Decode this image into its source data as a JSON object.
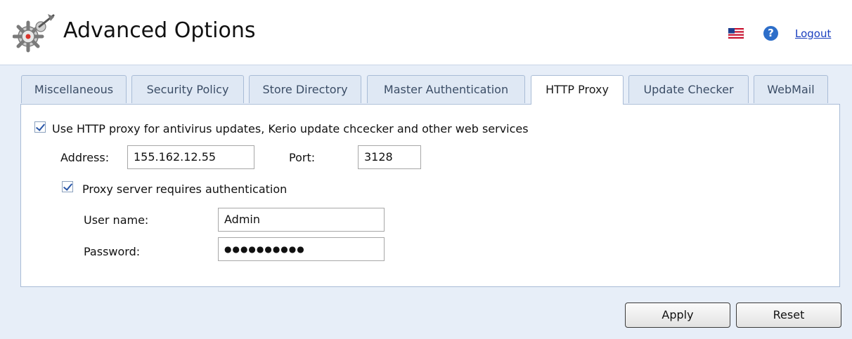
{
  "header": {
    "title": "Advanced Options",
    "logout_label": "Logout",
    "help_glyph": "?",
    "icons": [
      "gear-tools-icon",
      "us-flag-icon",
      "help-icon"
    ]
  },
  "tabs": [
    {
      "label": "Miscellaneous",
      "active": false
    },
    {
      "label": "Security Policy",
      "active": false
    },
    {
      "label": "Store Directory",
      "active": false
    },
    {
      "label": "Master Authentication",
      "active": false
    },
    {
      "label": "HTTP Proxy",
      "active": true
    },
    {
      "label": "Update Checker",
      "active": false
    },
    {
      "label": "WebMail",
      "active": false
    }
  ],
  "proxy": {
    "use_proxy_label": "Use HTTP proxy for antivirus updates, Kerio update chcecker and other web services",
    "use_proxy_checked": true,
    "address_label": "Address:",
    "address_value": "155.162.12.55",
    "port_label": "Port:",
    "port_value": "3128",
    "auth_label": "Proxy server requires authentication",
    "auth_checked": true,
    "username_label": "User name:",
    "username_value": "Admin",
    "password_label": "Password:",
    "password_value": "●●●●●●●●●●"
  },
  "buttons": {
    "apply": "Apply",
    "reset": "Reset"
  }
}
